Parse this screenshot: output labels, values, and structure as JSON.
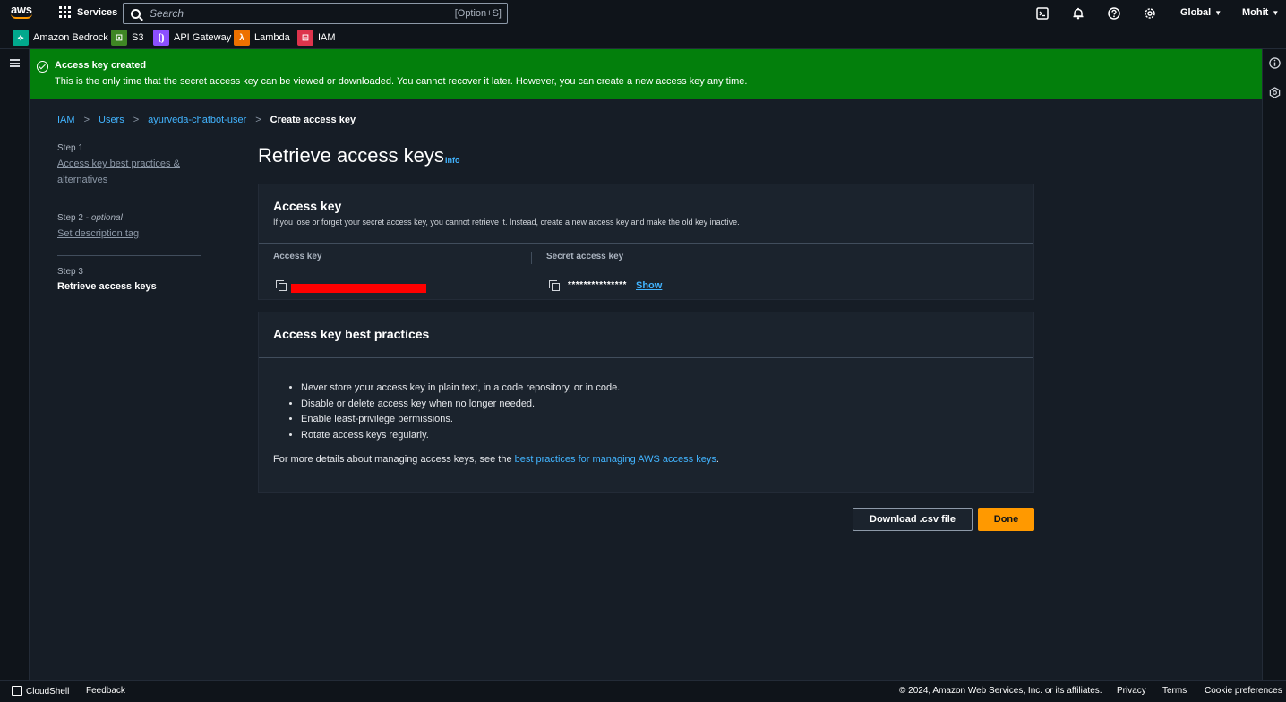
{
  "topnav": {
    "logo_text": "aws",
    "services_label": "Services",
    "search_placeholder": "Search",
    "search_shortcut": "[Option+S]",
    "region_label": "Global",
    "user_label": "Mohit",
    "icons": [
      "cloudshell-icon",
      "bell-icon",
      "help-icon",
      "settings-icon"
    ]
  },
  "favorites": [
    {
      "label": "Amazon Bedrock",
      "icon": "bedrock-icon",
      "color": "#01a88d"
    },
    {
      "label": "S3",
      "icon": "s3-icon",
      "color": "#3f8624"
    },
    {
      "label": "API Gateway",
      "icon": "api-gateway-icon",
      "color": "#8c4fff"
    },
    {
      "label": "Lambda",
      "icon": "lambda-icon",
      "color": "#ed7100"
    },
    {
      "label": "IAM",
      "icon": "iam-icon",
      "color": "#dd344c"
    }
  ],
  "flash": {
    "title": "Access key created",
    "message": "This is the only time that the secret access key can be viewed or downloaded. You cannot recover it later. However, you can create a new access key any time.",
    "color": "#037f0c"
  },
  "breadcrumb": {
    "items": [
      "IAM",
      "Users",
      "ayurveda-chatbot-user"
    ],
    "current": "Create access key"
  },
  "steps": [
    {
      "num": "Step 1",
      "label": "Access key best practices & alternatives"
    },
    {
      "num": "Step 2",
      "optional": "optional",
      "label": "Set description tag"
    },
    {
      "num": "Step 3",
      "label": "Retrieve access keys"
    }
  ],
  "page": {
    "title": "Retrieve access keys",
    "info": "Info"
  },
  "access_key_card": {
    "title": "Access key",
    "description": "If you lose or forget your secret access key, you cannot retrieve it. Instead, create a new access key and make the old key inactive.",
    "col_access_key": "Access key",
    "col_secret_key": "Secret access key",
    "secret_masked": "***************",
    "show_label": "Show"
  },
  "best_practices_card": {
    "title": "Access key best practices",
    "items": [
      "Never store your access key in plain text, in a code repository, or in code.",
      "Disable or delete access key when no longer needed.",
      "Enable least-privilege permissions.",
      "Rotate access keys regularly."
    ],
    "more_prefix": "For more details about managing access keys, see the",
    "more_link": "best practices for managing AWS access keys",
    "more_suffix": "."
  },
  "actions": {
    "download_label": "Download .csv file",
    "done_label": "Done",
    "accent": "#ff9900"
  },
  "footer": {
    "cloudshell": "CloudShell",
    "feedback": "Feedback",
    "copyright": "© 2024, Amazon Web Services, Inc. or its affiliates.",
    "privacy": "Privacy",
    "terms": "Terms",
    "cookies": "Cookie preferences"
  }
}
